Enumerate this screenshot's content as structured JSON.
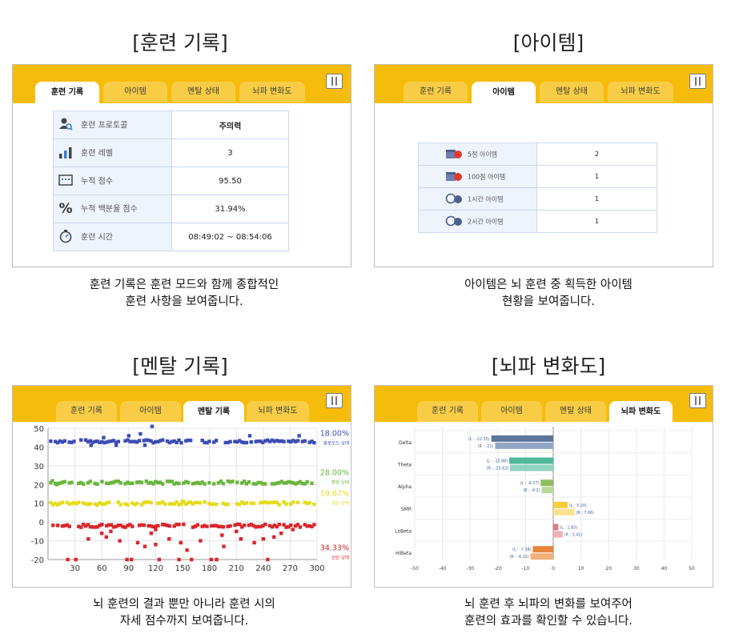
{
  "tabs": [
    "훈련 기록",
    "아이템",
    "멘탈 상태",
    "뇌파 변화도"
  ],
  "tab_mental_record": "멘탈 기록",
  "sections": {
    "record": {
      "title": "[훈련 기록]",
      "caption_l1": "훈련 기록은 훈련 모드와 함께 종합적인",
      "caption_l2": "훈련 사항을 보여줍니다."
    },
    "items": {
      "title": "[아이템]",
      "caption_l1": "아이템은 뇌 훈련 중 획득한 아이템",
      "caption_l2": "현황을 보여줍니다."
    },
    "mental": {
      "title": "[멘탈 기록]",
      "caption_l1": "뇌 훈련의 결과 뿐만 아니라 훈련 시의",
      "caption_l2": "자세 점수까지 보여줍니다."
    },
    "brain": {
      "title": "[뇌파 변화도]",
      "caption_l1": "뇌 훈련 후 뇌파의 변화를 보여주어",
      "caption_l2": "훈련의 효과를 확인할 수 있습니다."
    }
  },
  "record_rows": [
    {
      "icon": "user-search-icon",
      "label": "훈련 프로토콜",
      "value": "주의력"
    },
    {
      "icon": "level-bars-icon",
      "label": "훈련 레벨",
      "value": "3"
    },
    {
      "icon": "score-panel-icon",
      "label": "누적 점수",
      "value": "95.50"
    },
    {
      "icon": "percent-icon",
      "label": "누적 백분율 점수",
      "value": "31.94%"
    },
    {
      "icon": "stopwatch-icon",
      "label": "훈련 시간",
      "value": "08:49:02 ~ 08:54:06"
    }
  ],
  "item_rows": [
    {
      "icon": "gift-5-icon",
      "label": "5점 아이템",
      "value": "2"
    },
    {
      "icon": "gift-100-icon",
      "label": "100점 아이템",
      "value": "1"
    },
    {
      "icon": "clock-1h-icon",
      "label": "1시간 아이템",
      "value": "1"
    },
    {
      "icon": "clock-2h-icon",
      "label": "2시간 아이템",
      "value": "1"
    }
  ],
  "colors": {
    "accent": "#f6bc0c",
    "tab_inactive": "#f8cd45",
    "blue": "#3c4db5",
    "green": "#6ab53c",
    "yellow": "#e4dc1c",
    "red": "#d9272b"
  },
  "chart_data": [
    {
      "type": "scatter",
      "x_ticks": [
        "30",
        "60",
        "90",
        "120",
        "150",
        "180",
        "210",
        "240",
        "270",
        "300"
      ],
      "y_ticks": [
        "50",
        "40",
        "30",
        "20",
        "10",
        "0",
        "-10",
        "-20"
      ],
      "xlim": [
        0,
        300
      ],
      "ylim": [
        -20,
        50
      ],
      "grid": true,
      "series": [
        {
          "color": "#3c4db5",
          "center": 43,
          "label_pct": "18.00%",
          "label_name": "흥분모드 상태",
          "outliers": [
            [
              116,
              51
            ],
            [
              103,
              47
            ],
            [
              108,
              41
            ],
            [
              62,
              45
            ],
            [
              90,
              46
            ],
            [
              225,
              46
            ],
            [
              280,
              46
            ],
            [
              48,
              41
            ],
            [
              76,
              41
            ]
          ]
        },
        {
          "color": "#6ab53c",
          "center": 21,
          "label_pct": "28.00%",
          "label_name": "편정 상태",
          "outliers": [
            [
              5,
              22
            ],
            [
              10,
              20
            ]
          ]
        },
        {
          "color": "#e4dc1c",
          "center": 10,
          "label_pct": "19.67%",
          "label_name": "일반 상태",
          "outliers": [
            [
              55,
              9
            ],
            [
              150,
              11
            ]
          ]
        },
        {
          "color": "#d9272b",
          "center": -2,
          "label_pct": "34.33%",
          "label_name": "산만 상태",
          "outliers": [
            [
              22,
              -20
            ],
            [
              31,
              -20
            ],
            [
              88,
              -20
            ],
            [
              93,
              -20
            ],
            [
              182,
              -20
            ],
            [
              188,
              -20
            ],
            [
              245,
              -20
            ],
            [
              124,
              -20
            ],
            [
              146,
              -20
            ],
            [
              160,
              -20
            ],
            [
              155,
              -15
            ],
            [
              148,
              -11
            ],
            [
              100,
              -11
            ],
            [
              108,
              -13
            ],
            [
              120,
              -12
            ],
            [
              135,
              -9
            ],
            [
              170,
              -10
            ],
            [
              194,
              -7
            ],
            [
              230,
              -11
            ],
            [
              240,
              -9
            ],
            [
              196,
              -13
            ],
            [
              252,
              -8
            ],
            [
              60,
              -6
            ],
            [
              65,
              -8
            ],
            [
              70,
              -5
            ],
            [
              45,
              -9
            ],
            [
              80,
              -10
            ],
            [
              120,
              -4
            ],
            [
              115,
              -6
            ],
            [
              210,
              -5
            ],
            [
              215,
              -9
            ],
            [
              260,
              -6
            ],
            [
              273,
              -4
            ]
          ]
        }
      ]
    },
    {
      "type": "bar",
      "categories": [
        "Delta",
        "Theta",
        "Alpha",
        "SMR",
        "LoBeta",
        "HiBeta"
      ],
      "x_ticks": [
        "-50",
        "-40",
        "-30",
        "-20",
        "-10",
        "0",
        "10",
        "20",
        "30",
        "40",
        "50"
      ],
      "xlim": [
        -50,
        50
      ],
      "grid": true,
      "series": [
        {
          "name": "L",
          "values": [
            -22.35,
            -15.88,
            -4.57,
            5.2,
            1.83,
            -7.38
          ]
        },
        {
          "name": "R",
          "values": [
            -21.0,
            -15.6,
            -4.2,
            7.66,
            3.41,
            -8.22
          ]
        }
      ],
      "bar_labels": [
        [
          "(L : -22.35)",
          "(R : -21)"
        ],
        [
          "(L : -15.88)",
          "(R : -15.63)"
        ],
        [
          "(L : -4.57)",
          "(R : -4.2)"
        ],
        [
          "(L : 5.20)",
          "(R : 7.66)"
        ],
        [
          "(L : 1.83)",
          "(R : 3.41)"
        ],
        [
          "(L : -7.38)",
          "(R : -8.22)"
        ]
      ],
      "colors_L": [
        "#5b759c",
        "#4fb89b",
        "#8fbe62",
        "#f6cd3a",
        "#e27a84",
        "#e8833a"
      ],
      "colors_R": [
        "#93a6c4",
        "#8fd4bf",
        "#b9d99a",
        "#fbe190",
        "#efb0b6",
        "#f2b07b"
      ]
    }
  ]
}
